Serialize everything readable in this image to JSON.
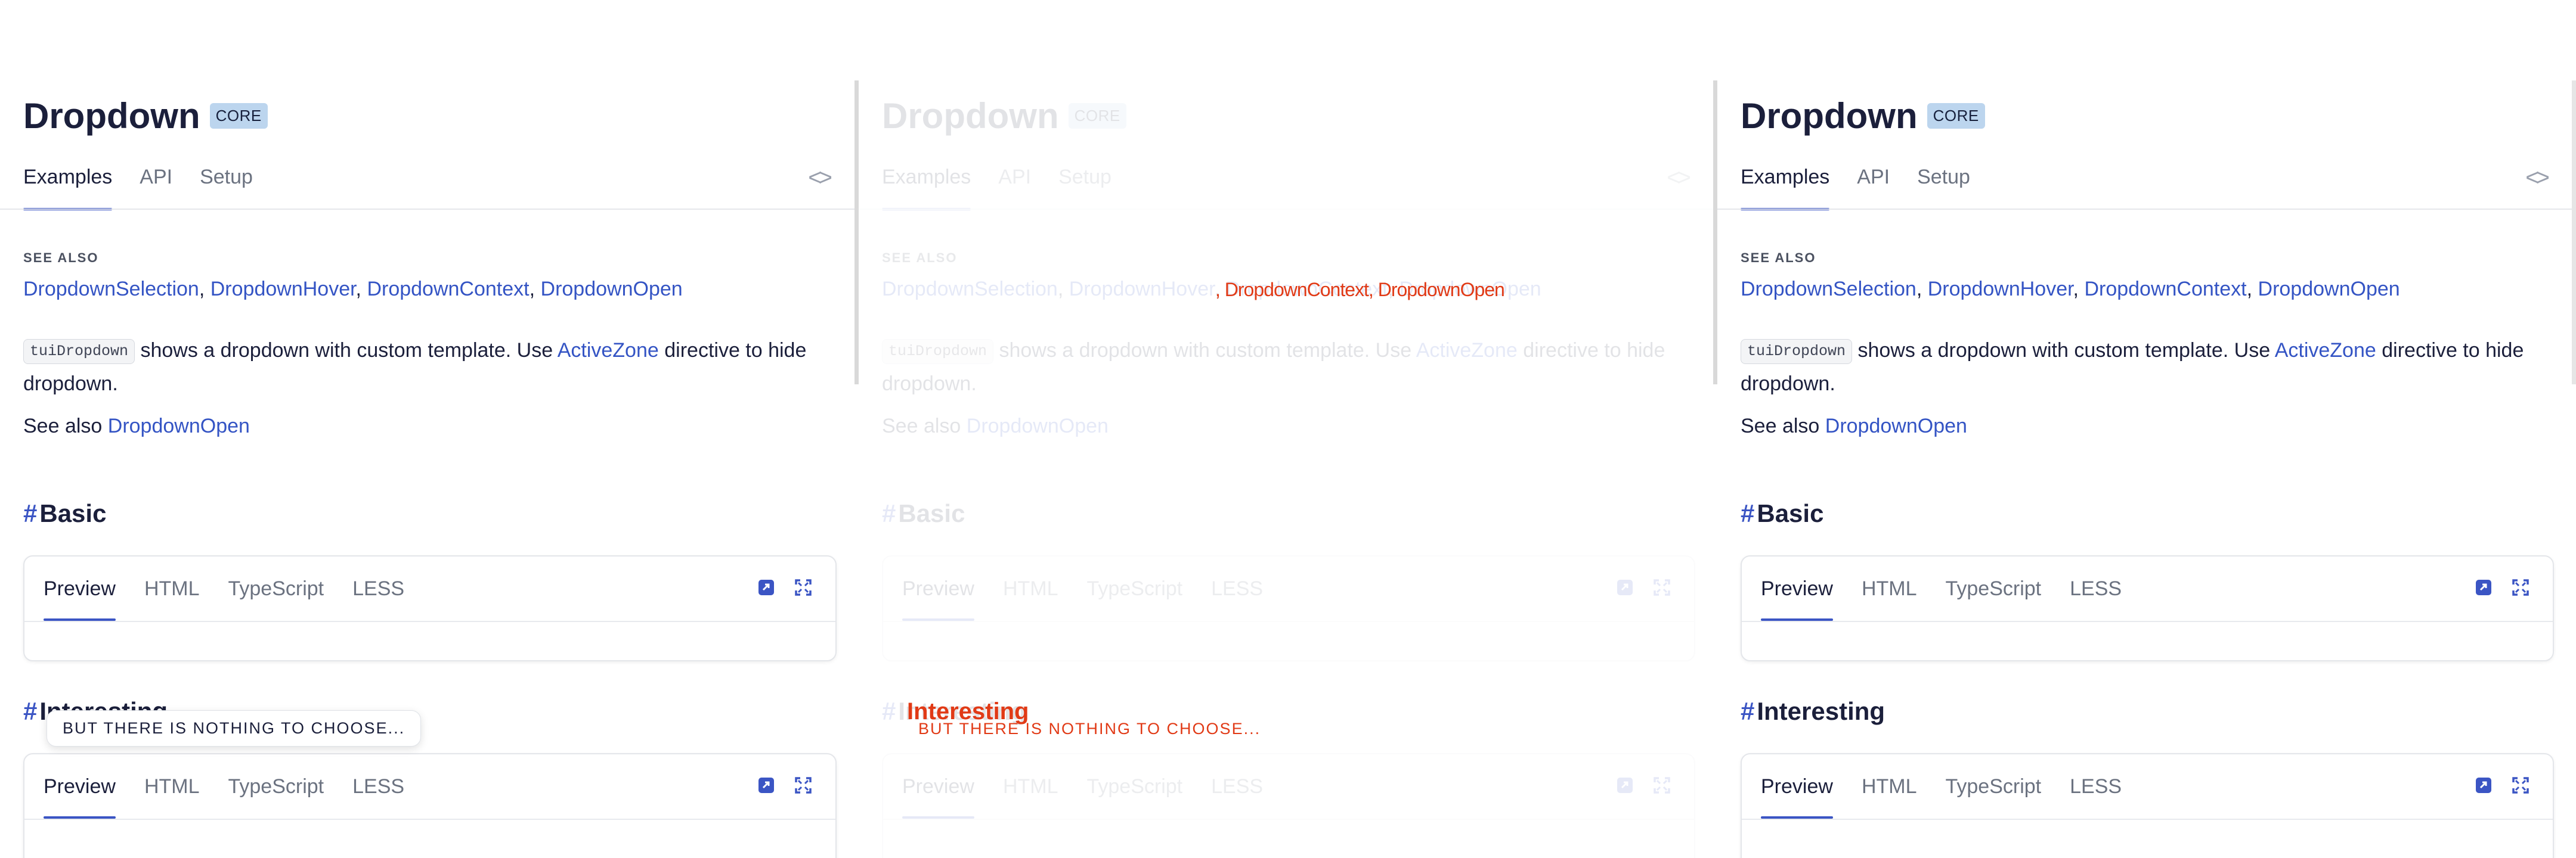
{
  "page": {
    "title": "Dropdown",
    "badge": "CORE",
    "tabs": [
      "Examples",
      "API",
      "Setup"
    ],
    "see_also_heading": "SEE ALSO",
    "see_also_links": [
      "DropdownSelection",
      "DropdownHover",
      "DropdownContext",
      "DropdownOpen"
    ],
    "description": {
      "code": "tuiDropdown",
      "text_before_link": " shows a dropdown with custom template. Use ",
      "link": "ActiveZone",
      "text_after_link": " directive to hide dropdown."
    },
    "see_also_line": {
      "prefix": "See also ",
      "link": "DropdownOpen"
    },
    "sections": [
      {
        "title": "Basic",
        "hash": "#",
        "tabs": [
          "Preview",
          "HTML",
          "TypeScript",
          "LESS"
        ]
      },
      {
        "title": "Interesting",
        "hash": "#",
        "tabs": [
          "Preview",
          "HTML",
          "TypeScript",
          "LESS"
        ]
      }
    ],
    "tooltip": "BUT THERE IS NOTHING TO CHOOSE...",
    "code_toggle_icon": "code-brackets-icon",
    "card_icons": [
      "open-in-editor-icon",
      "fullscreen-icon"
    ]
  },
  "ghost_overlay": {
    "links_tail": ", DropdownContext, DropdownOpen",
    "section_title": "Interesting",
    "tooltip": "BUT THERE IS NOTHING TO CHOOSE..."
  },
  "colors": {
    "accent": "#3b55c4",
    "link": "#3454c4",
    "badge_bg": "#bcd5ee",
    "overlay_red": "#e13a16"
  }
}
